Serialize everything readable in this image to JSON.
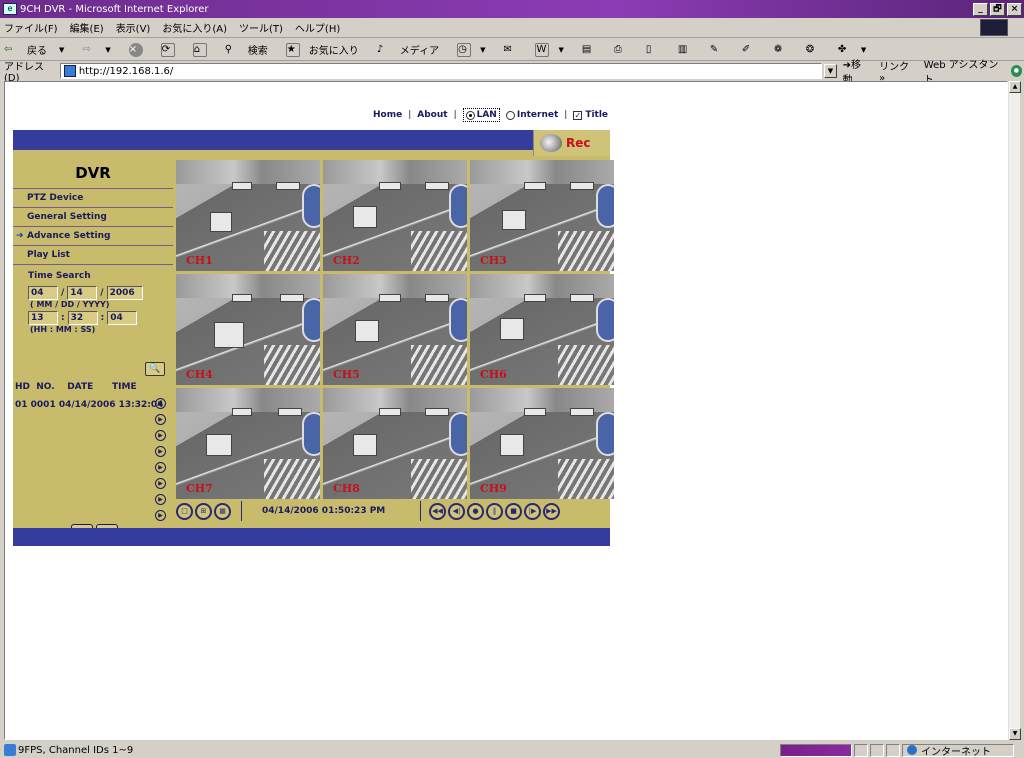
{
  "window": {
    "title": "9CH DVR - Microsoft Internet Explorer",
    "min": "_",
    "max": "🗗",
    "close": "×"
  },
  "menubar": [
    "ファイル(F)",
    "編集(E)",
    "表示(V)",
    "お気に入り(A)",
    "ツール(T)",
    "ヘルプ(H)"
  ],
  "toolbar": {
    "back": "戻る",
    "search": "検索",
    "favorites": "お気に入り",
    "media": "メディア"
  },
  "address": {
    "label": "アドレス(D)",
    "url": "http://192.168.1.6/",
    "go": "移動",
    "links": "リンク »",
    "assistant": "Web アシスタント"
  },
  "nav": {
    "home": "Home",
    "about": "About",
    "lan": "LAN",
    "internet": "Internet",
    "title": "Title",
    "sep": "|"
  },
  "dvr": {
    "heading": "DVR",
    "rec": "Rec",
    "menu": [
      "PTZ Device",
      "General Setting",
      "Advance Setting",
      "Play List"
    ],
    "time_search": "Time Search",
    "date": {
      "mm": "04",
      "dd": "14",
      "yyyy": "2006",
      "slash": "/"
    },
    "date_hint": "( MM / DD / YYYY)",
    "time": {
      "hh": "13",
      "mm": "32",
      "ss": "04",
      "colon": ":"
    },
    "time_hint": "(HH : MM : SS)",
    "list_header": "HD  NO.    DATE      TIME",
    "list_row": "01 0001 04/14/2006 13:32:04",
    "play_symbol": "▶",
    "up": "▲",
    "down": "▼",
    "magnifier": "🔍"
  },
  "channels": [
    "CH1",
    "CH2",
    "CH3",
    "CH4",
    "CH5",
    "CH6",
    "CH7",
    "CH8",
    "CH9"
  ],
  "controls": {
    "clock": "04/14/2006 01:50:23 PM",
    "layout1": "□",
    "layout4": "⊞",
    "layout9": "▦",
    "rewind": "◀◀",
    "stepback": "◀|",
    "record": "●",
    "pause": "‖",
    "stop": "■",
    "step": "|▶",
    "forward": "▶▶"
  },
  "status": {
    "text": "9FPS, Channel IDs 1~9",
    "zone": "インターネット"
  },
  "colors": {
    "accent": "#343c9c",
    "panel": "#c8bc6c",
    "rec": "#c8101a"
  }
}
